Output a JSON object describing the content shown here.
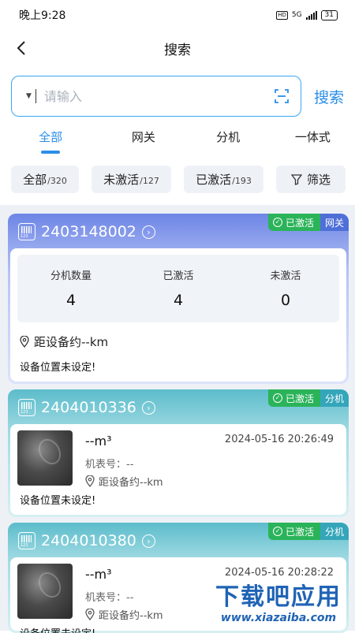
{
  "status_bar": {
    "time": "晚上9:28",
    "hd": "HD",
    "network": "5G",
    "battery": "31"
  },
  "nav": {
    "title": "搜索"
  },
  "search": {
    "placeholder": "请输入",
    "button_label": "搜索"
  },
  "tabs": [
    {
      "label": "全部",
      "active": true
    },
    {
      "label": "网关",
      "active": false
    },
    {
      "label": "分机",
      "active": false
    },
    {
      "label": "一体式",
      "active": false
    }
  ],
  "filters": [
    {
      "label": "全部",
      "count": "/320"
    },
    {
      "label": "未激活",
      "count": "/127"
    },
    {
      "label": "已激活",
      "count": "/193"
    },
    {
      "label": "筛选"
    }
  ],
  "devices": [
    {
      "id": "2403148002",
      "status": "已激活",
      "type": "网关",
      "stats": [
        {
          "label": "分机数量",
          "value": "4"
        },
        {
          "label": "已激活",
          "value": "4"
        },
        {
          "label": "未激活",
          "value": "0"
        }
      ],
      "distance": "距设备约--km",
      "location_note": "设备位置未设定!"
    },
    {
      "id": "2404010336",
      "status": "已激活",
      "type": "分机",
      "reading": "--m³",
      "timestamp": "2024-05-16 20:26:49",
      "meter_no": "机表号：--",
      "distance": "距设备约--km",
      "location_note": "设备位置未设定!"
    },
    {
      "id": "2404010380",
      "status": "已激活",
      "type": "分机",
      "reading": "--m³",
      "timestamp": "2024-05-16 20:28:22",
      "meter_no": "机表号：--",
      "distance": "距设备约--km",
      "location_note": "设备位置未设定!"
    }
  ],
  "watermark": {
    "title": "下载吧应用",
    "url": "www.xiazaiba.com"
  },
  "colors": {
    "accent": "#2a8ee8",
    "gateway_header": "#6d85e6",
    "extension_header": "#5cbccb",
    "active_badge": "#2bb35a"
  }
}
